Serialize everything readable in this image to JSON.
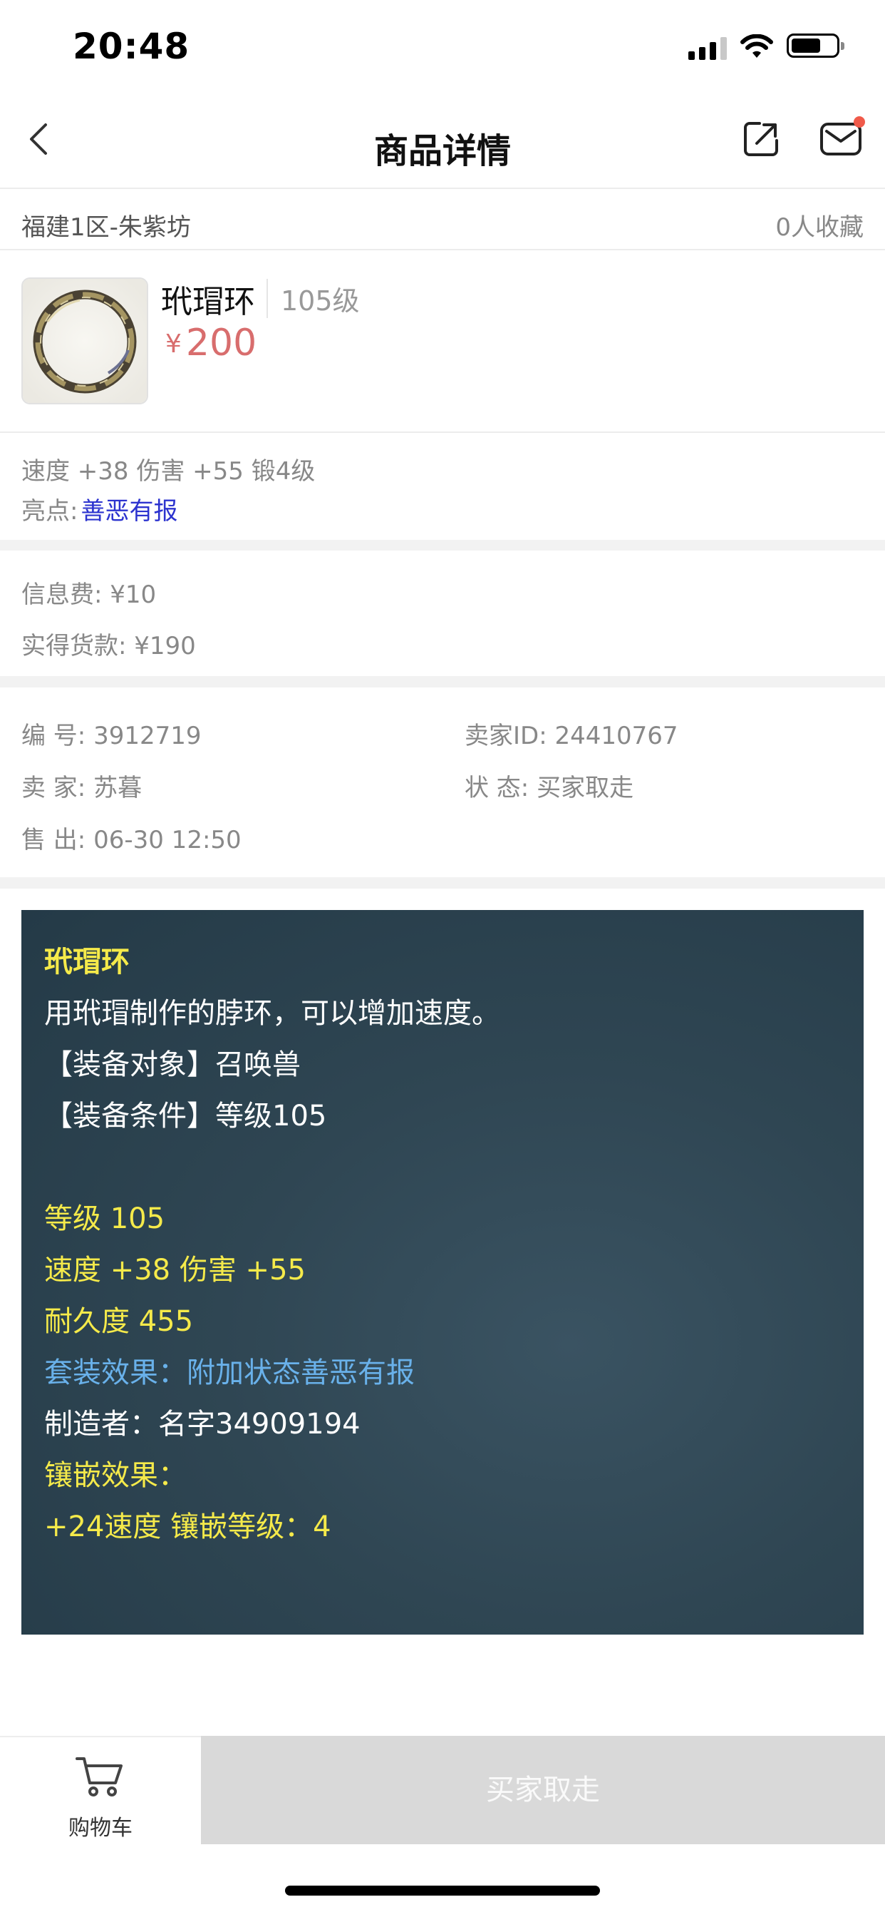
{
  "status_bar": {
    "time": "20:48"
  },
  "nav": {
    "title": "商品详情"
  },
  "server_row": {
    "server": "福建1区-朱紫坊",
    "favorites": "0人收藏"
  },
  "product": {
    "name": "玳瑁环",
    "level": "105级",
    "currency": "¥",
    "price": "200"
  },
  "attributes": {
    "line1": "速度 +38 伤害 +55 锻4级",
    "highlight_label": "亮点:",
    "highlight_value": "善恶有报"
  },
  "fees": {
    "info_fee": "信息费: ¥10",
    "net_payment": "实得货款: ¥190"
  },
  "info": {
    "id_label": "编 号:",
    "id_value": "3912719",
    "seller_id_label": "卖家ID:",
    "seller_id_value": "24410767",
    "seller_label": "卖 家:",
    "seller_value": "苏暮",
    "status_label": "状 态:",
    "status_value": "买家取走",
    "sold_label": "售 出:",
    "sold_value": "06-30 12:50"
  },
  "description": {
    "lines": [
      {
        "text": "玳瑁环",
        "color": "#f5ea4a"
      },
      {
        "text": "用玳瑁制作的脖环，可以增加速度。",
        "color": "#ffffff"
      },
      {
        "text": "【装备对象】召唤兽",
        "color": "#ffffff"
      },
      {
        "text": "【装备条件】等级105",
        "color": "#ffffff"
      },
      {
        "text": "等级 105",
        "color": "#f5ea4a"
      },
      {
        "text": "速度 +38 伤害 +55",
        "color": "#f5ea4a"
      },
      {
        "text": "耐久度 455",
        "color": "#f5ea4a"
      },
      {
        "text": "套装效果：附加状态善恶有报",
        "color": "#69b1ea"
      },
      {
        "text": "制造者：名字34909194",
        "color": "#ffffff"
      },
      {
        "text": "镶嵌效果：",
        "color": "#f5ea4a"
      },
      {
        "text": "+24速度 镶嵌等级：4",
        "color": "#f5ea4a"
      }
    ]
  },
  "bottom": {
    "cart_label": "购物车",
    "action_label": "买家取走"
  },
  "colors": {
    "price": "#d86d6d",
    "highlight": "#2c33cf",
    "desc_bg": "#2f4653",
    "notification_dot": "#f05a4a"
  }
}
